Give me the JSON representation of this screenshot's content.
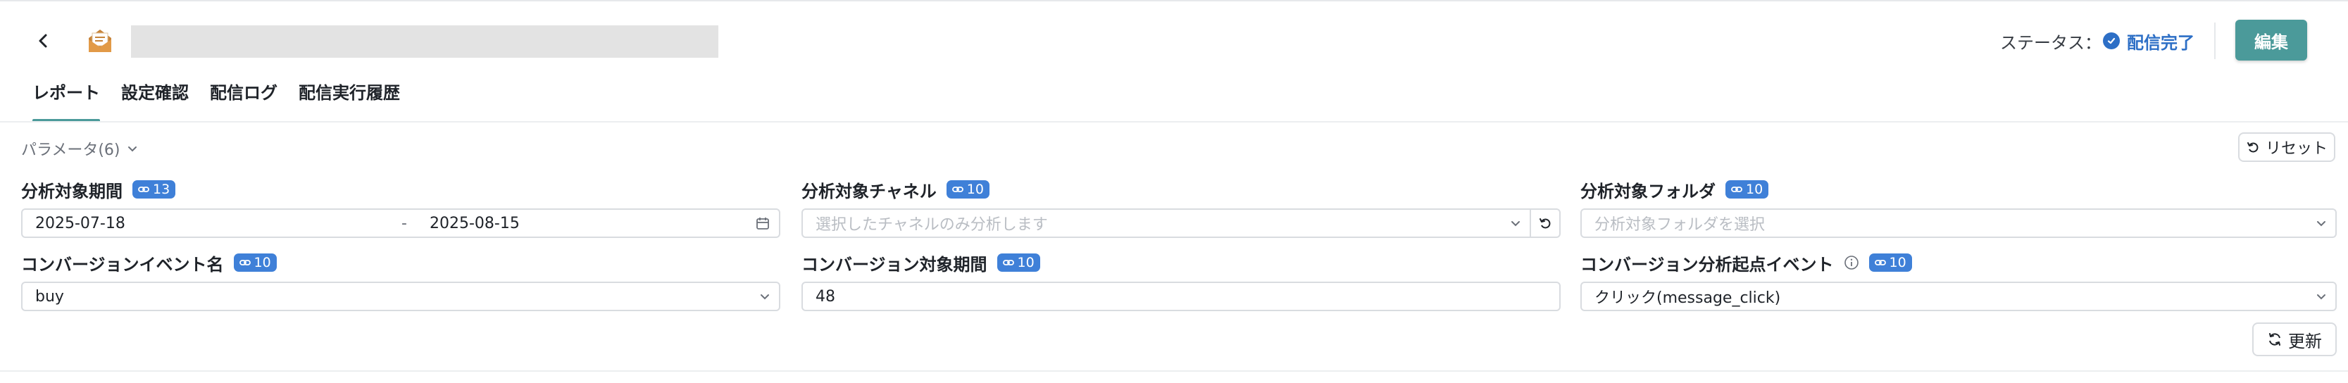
{
  "header": {
    "status_label": "ステータス：",
    "status_value": "配信完了",
    "edit_label": "編集"
  },
  "tabs": [
    {
      "label": "レポート",
      "active": true
    },
    {
      "label": "設定確認"
    },
    {
      "label": "配信ログ"
    },
    {
      "label": "配信実行履歴"
    }
  ],
  "params": {
    "toggle_label": "パラメータ(6)",
    "reset_label": "リセット",
    "update_label": "更新",
    "fields": {
      "period": {
        "label": "分析対象期間",
        "badge": "13",
        "start": "2025-07-18",
        "separator": "-",
        "end": "2025-08-15"
      },
      "channel": {
        "label": "分析対象チャネル",
        "badge": "10",
        "placeholder": "選択したチャネルのみ分析します"
      },
      "folder": {
        "label": "分析対象フォルダ",
        "badge": "10",
        "placeholder": "分析対象フォルダを選択"
      },
      "conv_event": {
        "label": "コンバージョンイベント名",
        "badge": "10",
        "value": "buy"
      },
      "conv_period": {
        "label": "コンバージョン対象期間",
        "badge": "10",
        "value": "48"
      },
      "conv_origin": {
        "label": "コンバージョン分析起点イベント",
        "badge": "10",
        "value": "クリック(message_click)"
      }
    }
  },
  "colors": {
    "accent": "#4b9a9a",
    "badge": "#3f80d8",
    "status": "#2d6fc6"
  }
}
